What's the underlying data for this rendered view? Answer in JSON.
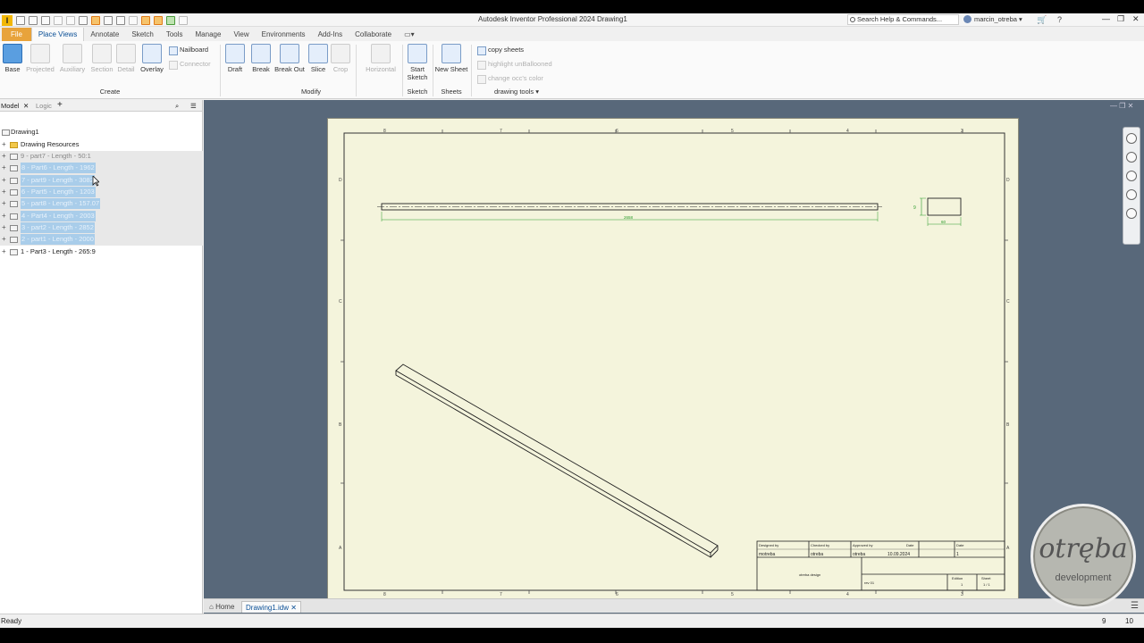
{
  "titlebar": {
    "app_title": "Autodesk Inventor Professional 2024   Drawing1",
    "search_placeholder": "Search Help & Commands...",
    "user_name": "marcin_otreba",
    "logo_letter": "I"
  },
  "ribbon": {
    "tabs": [
      {
        "label": "File"
      },
      {
        "label": "Place Views"
      },
      {
        "label": "Annotate"
      },
      {
        "label": "Sketch"
      },
      {
        "label": "Tools"
      },
      {
        "label": "Manage"
      },
      {
        "label": "View"
      },
      {
        "label": "Environments"
      },
      {
        "label": "Add-Ins"
      },
      {
        "label": "Collaborate"
      }
    ],
    "create": {
      "base": "Base",
      "projected": "Projected",
      "auxiliary": "Auxiliary",
      "section": "Section",
      "detail": "Detail",
      "overlay": "Overlay",
      "nailboard": "Nailboard",
      "connector": "Connector",
      "group_label": "Create"
    },
    "modify": {
      "draft": "Draft",
      "break": "Break",
      "break_out": "Break Out",
      "slice": "Slice",
      "crop": "Crop",
      "horizontal": "Horizontal",
      "group_label": "Modify"
    },
    "sketch": {
      "start_sketch_1": "Start",
      "start_sketch_2": "Sketch",
      "group_label": "Sketch"
    },
    "sheets": {
      "new_sheet": "New Sheet",
      "group_label": "Sheets"
    },
    "drawing_tools": {
      "copy_sheets": "copy sheets",
      "highlight": "highlight unBallooned",
      "change_color": "change occ's color",
      "group_label": "drawing tools"
    }
  },
  "browser": {
    "tabs": {
      "model": "Model",
      "logic": "Logic"
    },
    "root": "Drawing1",
    "resources": "Drawing Resources",
    "items": [
      {
        "label": "9 - part7 - Length - 50:1",
        "selected": false
      },
      {
        "label": "8 - Part6 - Length - 1962",
        "selected": true
      },
      {
        "label": "7 - part9 - Length - 3082",
        "selected": true
      },
      {
        "label": "6 - Part5 - Length - 1203",
        "selected": true
      },
      {
        "label": "5 - part8 - Length - 157.07",
        "selected": true
      },
      {
        "label": "4 - Part4 - Length - 2003",
        "selected": true
      },
      {
        "label": "3 - part2 - Length - 2852",
        "selected": true
      },
      {
        "label": "2 - part1 - Length - 2000",
        "selected": true
      },
      {
        "label": "1 - Part3 - Length - 265:9",
        "selected": false
      }
    ]
  },
  "drawing": {
    "zone_cols": [
      "8",
      "7",
      "6",
      "5",
      "4",
      "3",
      "2",
      "1"
    ],
    "zone_rows": [
      "D",
      "C",
      "B",
      "A"
    ],
    "dim_length": "2658",
    "dim_height": "9",
    "dim_width": "60",
    "titleblock": {
      "designed_by_label": "Designed by",
      "designed_by": "motreba",
      "checked_by_label": "Checked by",
      "checked_by": "otreba",
      "approved_by_label": "Approved by",
      "approved_by": "otreba",
      "date_label": "Date",
      "date": "10.09.2024",
      "date2_label": "Date",
      "date2": "1",
      "title": "otreba design",
      "doc_no": "rev 01",
      "edition_label": "Edition",
      "edition": "1",
      "sheet_label": "Sheet",
      "sheet": "1 / 1"
    }
  },
  "doc_tabs": {
    "home": "Home",
    "drawing": "Drawing1.idw"
  },
  "status": {
    "text": "Ready",
    "n1": "9",
    "n2": "10"
  },
  "watermark": {
    "line1": "otręba",
    "line2": "development"
  }
}
